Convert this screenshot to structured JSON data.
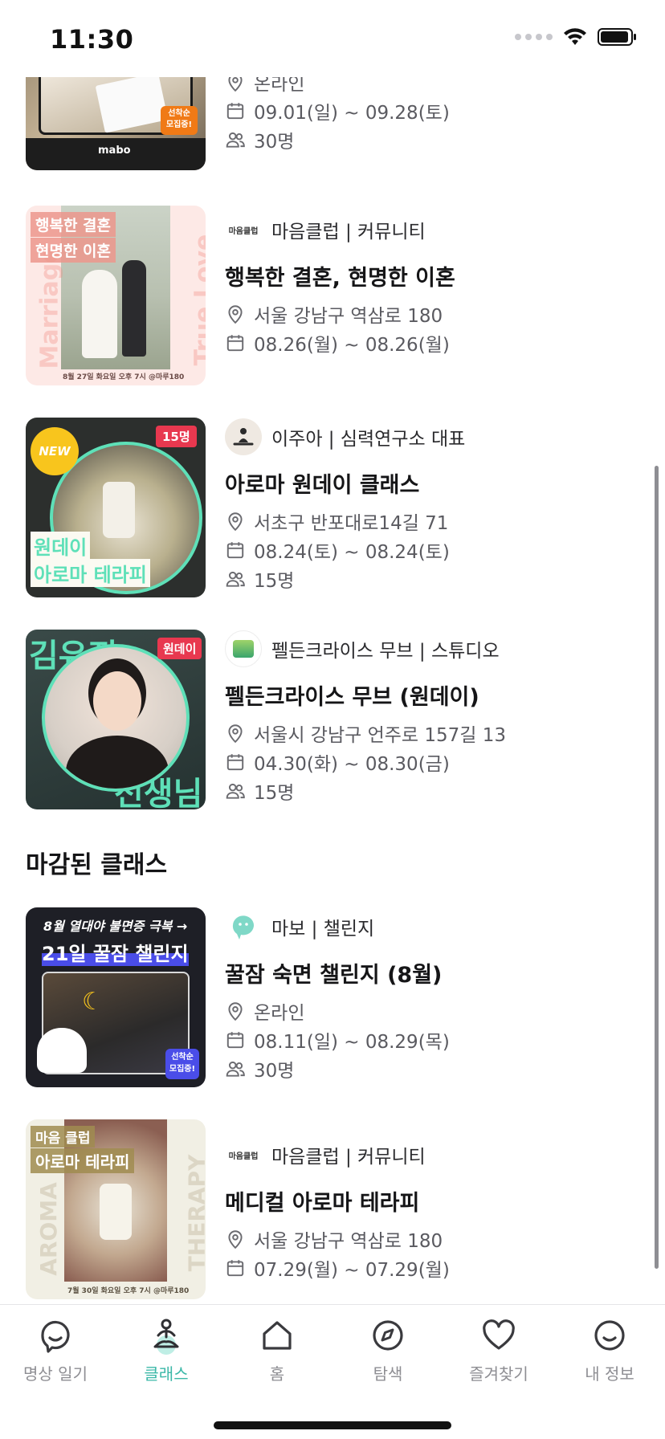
{
  "status_bar": {
    "time": "11:30"
  },
  "colors": {
    "accent": "#3cb8a8",
    "badge_red": "#e8384f",
    "badge_orange": "#f07a16",
    "badge_blue": "#4a4de8"
  },
  "cards": [
    {
      "title": "",
      "location": "온라인",
      "dates": "09.01(일) ~ 09.28(토)",
      "capacity": "30명",
      "thumb": {
        "brand": "mabo",
        "badge": "선착순 모집중!"
      }
    },
    {
      "org": "마음클럽 | 커뮤니티",
      "org_logo_text": "마음클럽",
      "title": "행복한 결혼, 현명한 이혼",
      "location": "서울 강남구 역삼로 180",
      "dates": "08.26(월) ~ 08.26(월)",
      "thumb": {
        "line1": "행복한 결혼",
        "line2": "현명한 이혼",
        "side_left": "Marriage",
        "side_right": "True Love",
        "footer": "8월 27일 화요일 오후 7시 @마루180"
      }
    },
    {
      "org": "이주아 | 심력연구소 대표",
      "title": "아로마 원데이 클래스",
      "location": "서초구 반포대로14길 71",
      "dates": "08.24(토) ~ 08.24(토)",
      "capacity": "15명",
      "thumb": {
        "new_badge": "NEW",
        "count_badge": "15명",
        "line1": "원데이",
        "line2": "아로마 테라피"
      }
    },
    {
      "org": "펠든크라이스 무브 | 스튜디오",
      "title": "펠든크라이스 무브 (원데이)",
      "location": "서울시 강남구 언주로 157길 13",
      "dates": "04.30(화) ~ 08.30(금)",
      "capacity": "15명",
      "thumb": {
        "badge": "원데이",
        "top_text": "김유진",
        "bottom_text": "선생님"
      }
    }
  ],
  "closed_section": {
    "title": "마감된 클래스",
    "cards": [
      {
        "org": "마보 | 챌린지",
        "title": "꿀잠 숙면 챌린지 (8월)",
        "location": "온라인",
        "dates": "08.11(일) ~ 08.29(목)",
        "capacity": "30명",
        "thumb": {
          "line1": "8월 열대야 불면증 극복 →",
          "line2": "21일 꿀잠 챌린지",
          "badge": "선착순 모집중!"
        }
      },
      {
        "org": "마음클럽 | 커뮤니티",
        "org_logo_text": "마음클럽",
        "title": "메디컬 아로마 테라피",
        "location": "서울 강남구 역삼로 180",
        "dates": "07.29(월) ~ 07.29(월)",
        "thumb": {
          "line1": "마음 클럽",
          "line2": "아로마 테라피",
          "side_left": "AROMA",
          "side_right": "THERAPY",
          "footer": "7월 30일 화요일 오후 7시 @마루180"
        }
      }
    ]
  },
  "tab_bar": {
    "tabs": [
      {
        "label": "명상 일기",
        "icon": "smile-bubble-icon"
      },
      {
        "label": "클래스",
        "icon": "meditation-icon",
        "active": true
      },
      {
        "label": "홈",
        "icon": "home-icon"
      },
      {
        "label": "탐색",
        "icon": "compass-icon"
      },
      {
        "label": "즐겨찾기",
        "icon": "heart-icon"
      },
      {
        "label": "내 정보",
        "icon": "smile-icon"
      }
    ]
  }
}
